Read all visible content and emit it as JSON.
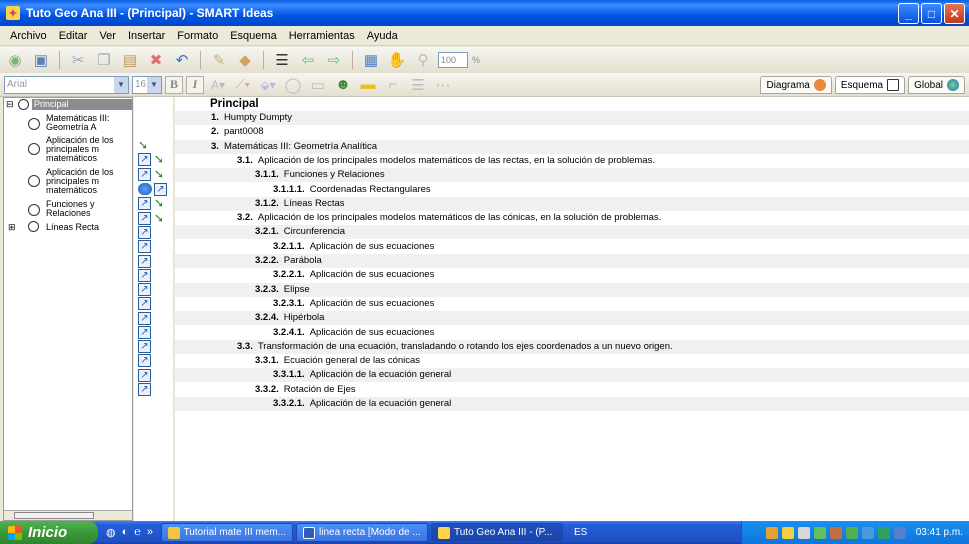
{
  "window": {
    "title": "Tuto Geo Ana III - (Principal) - SMART Ideas"
  },
  "menu": [
    "Archivo",
    "Editar",
    "Ver",
    "Insertar",
    "Formato",
    "Esquema",
    "Herramientas",
    "Ayuda"
  ],
  "toolbar": {
    "zoom": "100",
    "zoom_unit": "%"
  },
  "format": {
    "font": "Arial",
    "size": "16",
    "bold": "B",
    "italic": "I"
  },
  "view_tabs": [
    "Diagrama",
    "Esquema",
    "Global"
  ],
  "tree": [
    {
      "label": "Principal",
      "selected": true
    },
    {
      "label": "Matemáticas III: Geometría A"
    },
    {
      "label": "Aplicación de los principales m matemáticos"
    },
    {
      "label": "Aplicación de los principales m matemáticos"
    },
    {
      "label": "Funciones y Relaciones"
    },
    {
      "label": "Líneas Recta"
    }
  ],
  "outline": {
    "title": "Principal",
    "items": [
      {
        "num": "1.",
        "text": "Humpty Dumpty",
        "level": 0
      },
      {
        "num": "2.",
        "text": "pant0008",
        "level": 0
      },
      {
        "num": "3.",
        "text": "Matemáticas III: Geometría Analítica",
        "level": 0
      },
      {
        "num": "3.1.",
        "text": "Aplicación de los principales modelos matemáticos de las rectas, en la solución de problemas.",
        "level": 1
      },
      {
        "num": "3.1.1.",
        "text": "Funciones y Relaciones",
        "level": 2
      },
      {
        "num": "3.1.1.1.",
        "text": "Coordenadas Rectangulares",
        "level": 3
      },
      {
        "num": "3.1.2.",
        "text": "Líneas Rectas",
        "level": 2
      },
      {
        "num": "3.2.",
        "text": "Aplicación de los principales modelos matemáticos de las cónicas, en la solución de problemas.",
        "level": 1
      },
      {
        "num": "3.2.1.",
        "text": "Circunferencia",
        "level": 2
      },
      {
        "num": "3.2.1.1.",
        "text": "Aplicación de sus ecuaciones",
        "level": 3
      },
      {
        "num": "3.2.2.",
        "text": "Parábola",
        "level": 2
      },
      {
        "num": "3.2.2.1.",
        "text": "Aplicación de sus ecuaciones",
        "level": 3
      },
      {
        "num": "3.2.3.",
        "text": "Elipse",
        "level": 2
      },
      {
        "num": "3.2.3.1.",
        "text": "Aplicación de sus ecuaciones",
        "level": 3
      },
      {
        "num": "3.2.4.",
        "text": "Hipérbola",
        "level": 2
      },
      {
        "num": "3.2.4.1.",
        "text": "Aplicación de sus ecuaciones",
        "level": 3
      },
      {
        "num": "3.3.",
        "text": "Transformación de una ecuación, transladando o rotando los ejes coordenados a un nuevo origen.",
        "level": 1
      },
      {
        "num": "3.3.1.",
        "text": "Ecuación general de las cónicas",
        "level": 2
      },
      {
        "num": "3.3.1.1.",
        "text": "Aplicación de la ecuación general",
        "level": 3
      },
      {
        "num": "3.3.2.",
        "text": "Rotación de Ejes",
        "level": 2
      },
      {
        "num": "3.3.2.1.",
        "text": "Aplicación de la ecuación general",
        "level": 3
      }
    ]
  },
  "taskbar": {
    "start": "Inicio",
    "tasks": [
      "Tutorial mate III mem...",
      "linea recta [Modo de ...",
      "Tuto Geo Ana III - (P..."
    ],
    "lang": "ES",
    "clock": "03:41 p.m."
  },
  "colors": {
    "titlebar": "#0054e3",
    "selection": "#8c8c8c",
    "start": "#3a9a3a"
  }
}
